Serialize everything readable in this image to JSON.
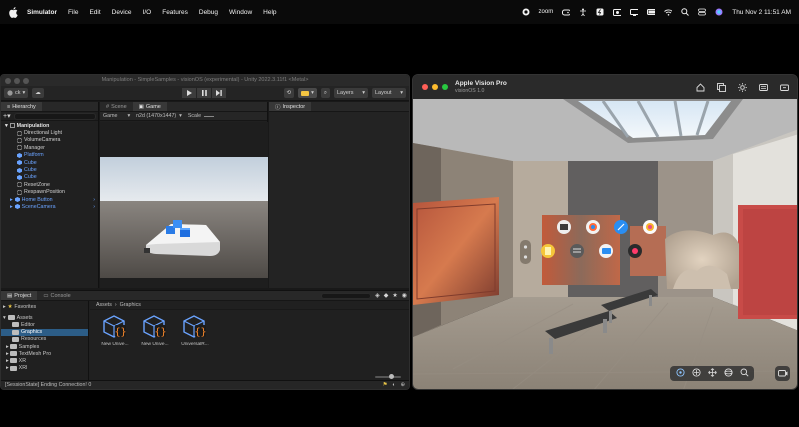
{
  "menubar": {
    "app": "Simulator",
    "items": [
      "File",
      "Edit",
      "Device",
      "I/O",
      "Features",
      "Debug",
      "Window",
      "Help"
    ],
    "status_zoom": "zoom",
    "datetime": "Thu Nov 2  11:51 AM"
  },
  "unity": {
    "title": "Manipulation - SimpleSamples - visionOS (experimental) - Unity 2022.3.11f1 <Metal>",
    "account_btn": "ck",
    "layers_label": "Layers",
    "layout_label": "Layout",
    "hierarchy": {
      "tab": "Hierarchy",
      "root": "Manipulation",
      "items": [
        {
          "label": "Directional Light",
          "blue": false
        },
        {
          "label": "VolumeCamera",
          "blue": false
        },
        {
          "label": "Manager",
          "blue": false
        },
        {
          "label": "Platform",
          "blue": true
        },
        {
          "label": "Cube",
          "blue": true
        },
        {
          "label": "Cube",
          "blue": true
        },
        {
          "label": "Cube",
          "blue": true
        },
        {
          "label": "ResetZone",
          "blue": false
        },
        {
          "label": "RespawnPosition",
          "blue": false
        },
        {
          "label": "Home Button",
          "blue": true
        },
        {
          "label": "SceneCamera",
          "blue": true
        }
      ]
    },
    "scene_tab": "Scene",
    "game_tab": "Game",
    "game_mode": "Game",
    "resolution": "n2d (1470x1447)",
    "scale_label": "Scale",
    "inspector_tab": "Inspector",
    "project_tab": "Project",
    "console_tab": "Console",
    "favorites": "Favorites",
    "assets_root": "Assets",
    "folders": [
      "Editor",
      "Graphics",
      "Resources",
      "Samples",
      "TextMesh Pro",
      "XR",
      "XRI"
    ],
    "selected_folder": "Graphics",
    "breadcrumb": [
      "Assets",
      "Graphics"
    ],
    "assets": [
      "New Unive...",
      "New Unive...",
      "UniversalR..."
    ],
    "status": "[SessionState] Ending Connection! 0"
  },
  "sim": {
    "name": "Apple Vision Pro",
    "os": "visionOS 1.0"
  },
  "colors": {
    "unity_bg": "#191919",
    "selection_blue": "#2c5d87",
    "hierarchy_blue": "#6aa3ff",
    "cube_blue": "#1f6fe0"
  }
}
